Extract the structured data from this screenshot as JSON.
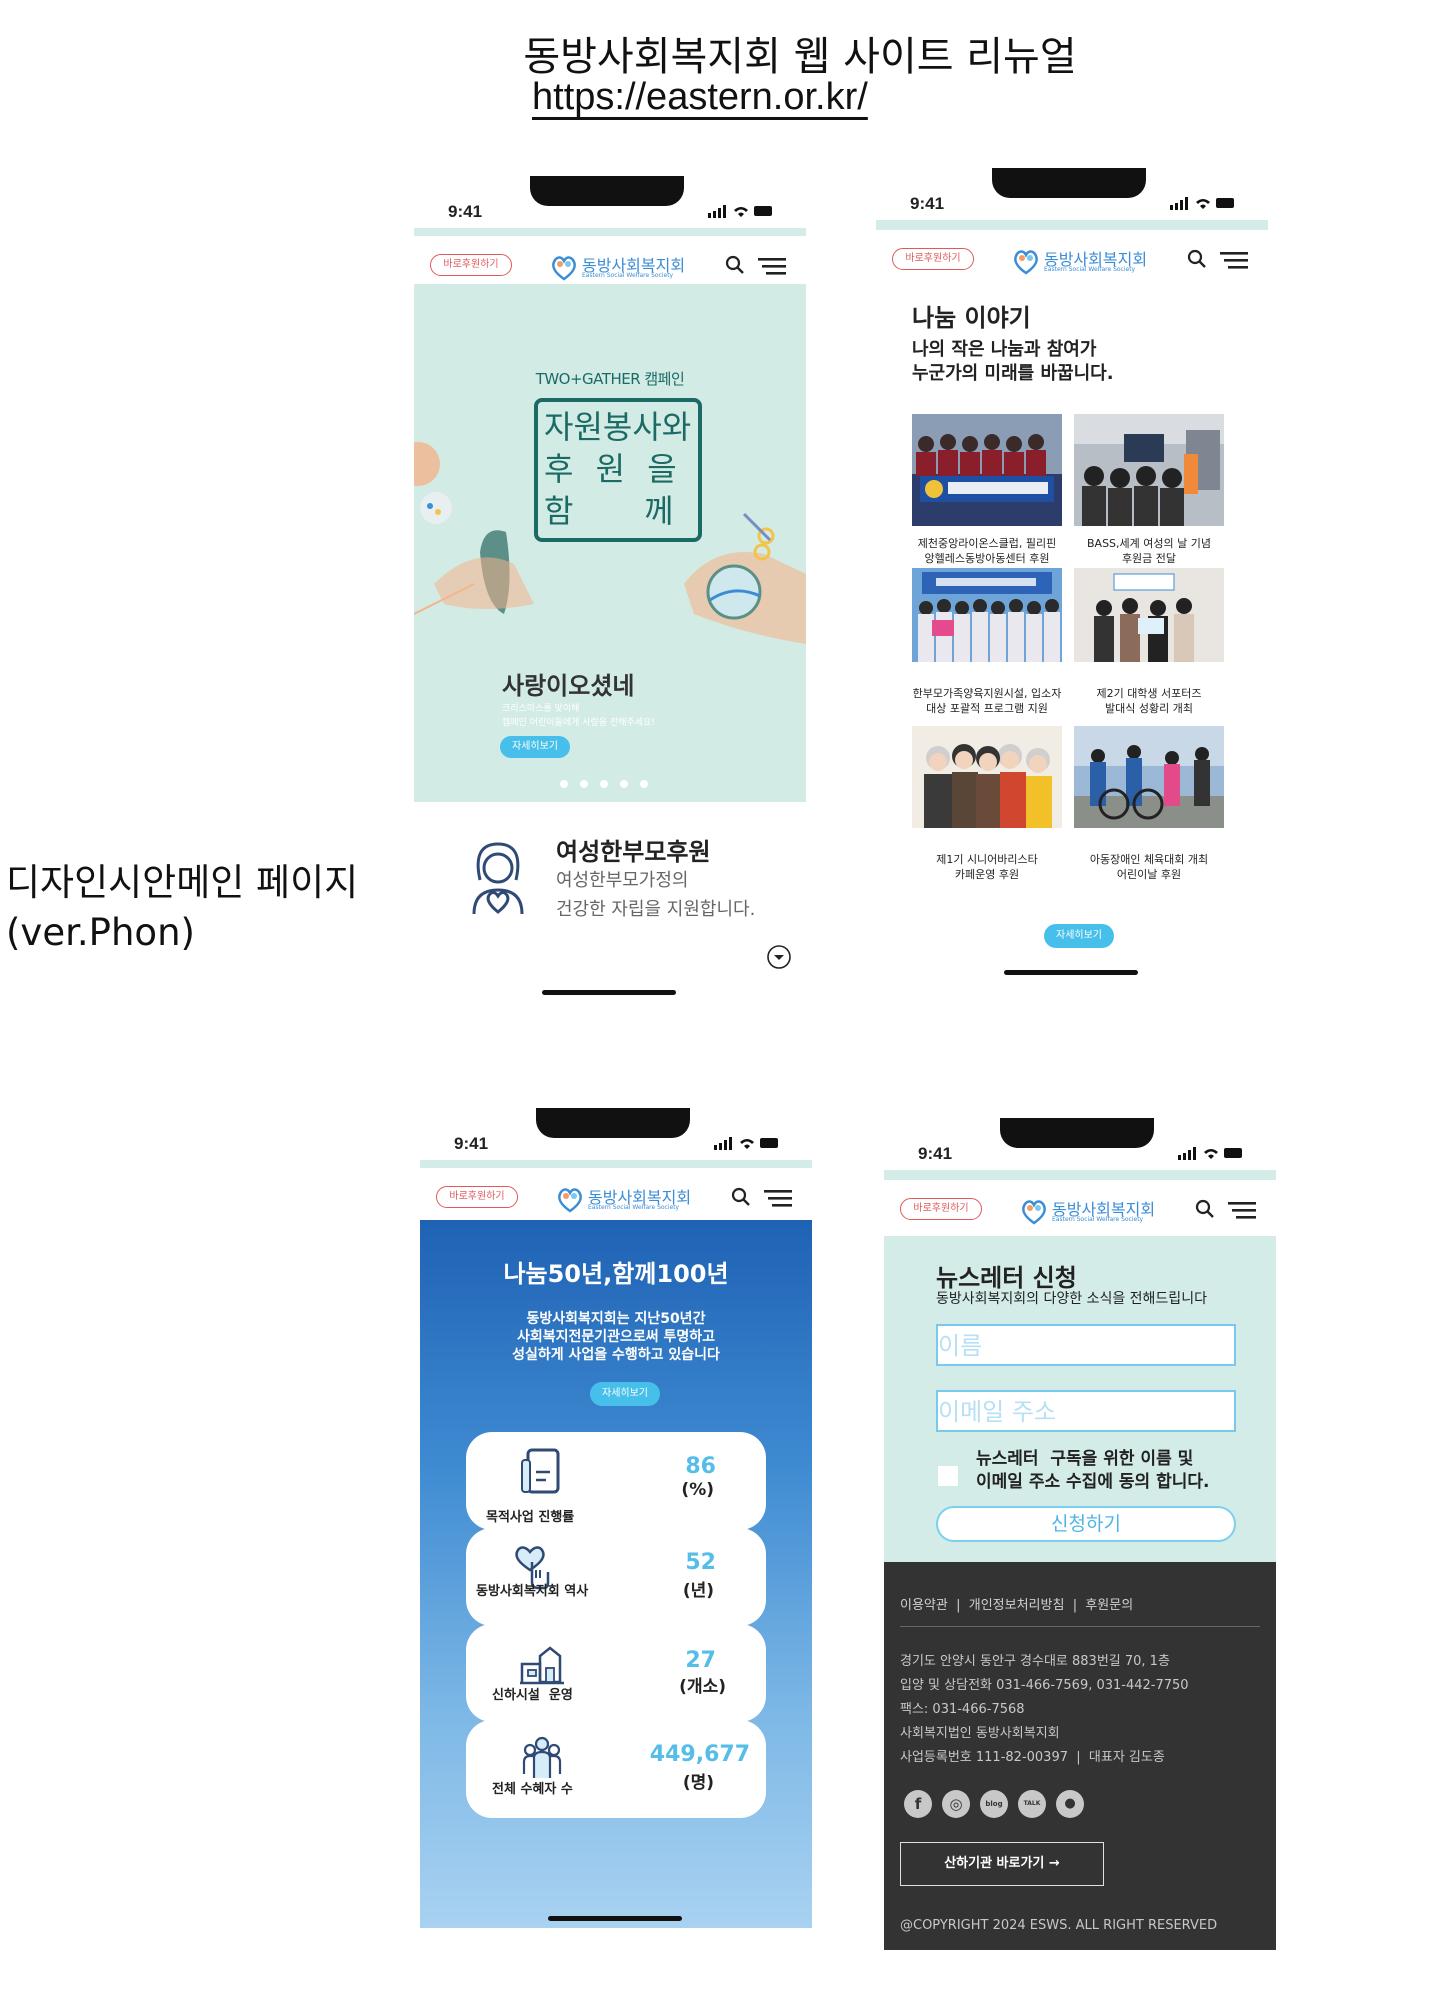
{
  "header": {
    "title": "동방사회복지회 웹 사이트 리뉴얼",
    "url": "https://eastern.or.kr/"
  },
  "side_label": {
    "line1": "디자인시안메인 페이지",
    "line2": "(ver.Phon)"
  },
  "common": {
    "status_time": "9:41",
    "donate_label": "바로후원하기",
    "logo_name": "동방사회복지회",
    "logo_sub": "Eastern Social Welfare Society",
    "brand_color": "#3a8dd6",
    "accent_color": "#46c0ea",
    "mint_color": "#d3ebe5"
  },
  "phone1": {
    "campaign_label": "TWO+GATHER 캠페인",
    "campaign_lines": [
      "자원봉사와",
      "후 원 을",
      "함    께"
    ],
    "hero_title": "사랑이오셨네",
    "hero_sub1": "크리스마스를 맞이해",
    "hero_sub2": "캠페인 어린이들에게 사랑을 전해주세요!",
    "more_label": "자세히보기",
    "slide_count": 5,
    "info_title": "여성한부모후원",
    "info_desc1": "여성한부모가정의",
    "info_desc2": "건강한 자립을 지원합니다."
  },
  "phone2": {
    "title": "나눔 이야기",
    "sub1": "나의 작은 나눔과 참여가",
    "sub2": "누군가의 미래를 바꿉니다.",
    "more_label": "자세히보기",
    "stories": [
      {
        "line1": "제천중앙라이온스클럽, 필리핀",
        "line2": "앙헬레스동방아동센터 후원"
      },
      {
        "line1": "BASS,세계 여성의 날 기념",
        "line2": "후원금 전달"
      },
      {
        "line1": "한부모가족양육지원시설, 입소자",
        "line2": "대상 포괄적 프로그램 지원"
      },
      {
        "line1": "제2기 대학생 서포터즈",
        "line2": "발대식 성황리 개최"
      },
      {
        "line1": "제1기 시니어바리스타",
        "line2": "카페운영 후원"
      },
      {
        "line1": "아동장애인 체육대회 개최",
        "line2": "어린이날 후원"
      }
    ]
  },
  "phone3": {
    "title": "나눔50년,함께100년",
    "desc1": "동방사회복지회는 지난50년간",
    "desc2": "사회복지전문기관으로써 투명하고",
    "desc3": "성실하게 사업을 수행하고 있습니다",
    "more_label": "자세히보기",
    "stats": [
      {
        "label": "목적사업 진행률",
        "value": "86",
        "unit": "(%)",
        "icon": "document-icon"
      },
      {
        "label": "동방사회복지회 역사",
        "value": "52",
        "unit": "(년)",
        "icon": "heart-hand-icon"
      },
      {
        "label": "신하시설  운영",
        "value": "27",
        "unit": "(개소)",
        "icon": "building-icon"
      },
      {
        "label": "전체 수혜자 수",
        "value": "449,677",
        "unit": "(명)",
        "icon": "people-icon"
      }
    ]
  },
  "phone4": {
    "nl_title": "뉴스레터 신청",
    "nl_sub": "동방사회복지회의 다양한 소식을 전해드립니다",
    "name_placeholder": "이름",
    "email_placeholder": "이메일 주소",
    "agree1": "뉴스레터  구독을 위한 이름 및",
    "agree2": "이메일 주소 수집에 동의 합니다.",
    "submit_label": "신청하기",
    "footer_links": "이용약관  |  개인정보처리방침  |  후원문의",
    "addr1": "경기도 안양시 동안구 경수대로 883번길 70, 1층",
    "addr2": "입양 및 상담전화 031-466-7569, 031-442-7750",
    "addr3": "팩스: 031-466-7568",
    "addr4": "사회복지법인 동방사회복지회",
    "addr5": "사업등록번호 111-82-00397  |  대표자 김도종",
    "sns": [
      "facebook-icon",
      "instagram-icon",
      "blog-icon",
      "talk-icon",
      "story-icon"
    ],
    "sns_labels": [
      "f",
      "◎",
      "blog",
      "TALK",
      "●"
    ],
    "affiliate_label": "산하기관 바로가기  →",
    "copyright": "@COPYRIGHT 2024 ESWS. ALL RIGHT RESERVED"
  }
}
